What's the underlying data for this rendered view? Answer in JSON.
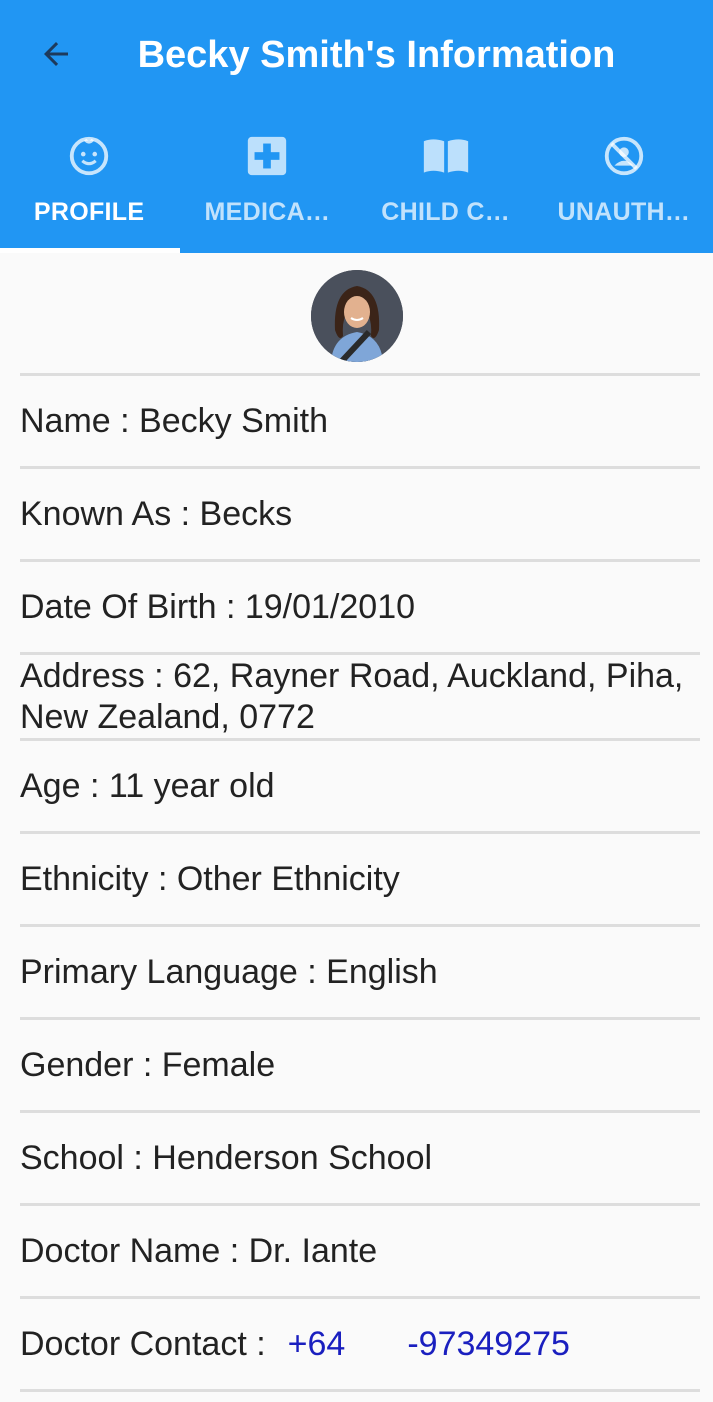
{
  "header": {
    "title": "Becky Smith's Information",
    "back_icon": "arrow-back-icon"
  },
  "tabs": [
    {
      "label": "PROFILE",
      "icon": "child-face-icon",
      "active": true
    },
    {
      "label": "MEDICA…",
      "icon": "medical-cross-icon",
      "active": false
    },
    {
      "label": "CHILD C…",
      "icon": "book-icon",
      "active": false
    },
    {
      "label": "UNAUTH…",
      "icon": "no-person-icon",
      "active": false
    }
  ],
  "profile": {
    "name": "Name : Becky Smith",
    "known_as": "Known As : Becks",
    "dob": "Date Of Birth : 19/01/2010",
    "address_line1": "Address : 62, Rayner Road, Auckland, Piha,",
    "address_line2": "New Zealand, 0772",
    "age": "Age : 11 year old",
    "ethnicity": "Ethnicity : Other Ethnicity",
    "language": "Primary Language : English",
    "gender": "Gender : Female",
    "school": "School : Henderson School",
    "doctor_name": "Doctor Name : Dr. Iante",
    "doctor_contact_label": "Doctor Contact :",
    "doctor_contact_code": "+64",
    "doctor_contact_number": "-97349275"
  },
  "colors": {
    "appbar": "#2196f3",
    "link": "#1a1fbf"
  }
}
